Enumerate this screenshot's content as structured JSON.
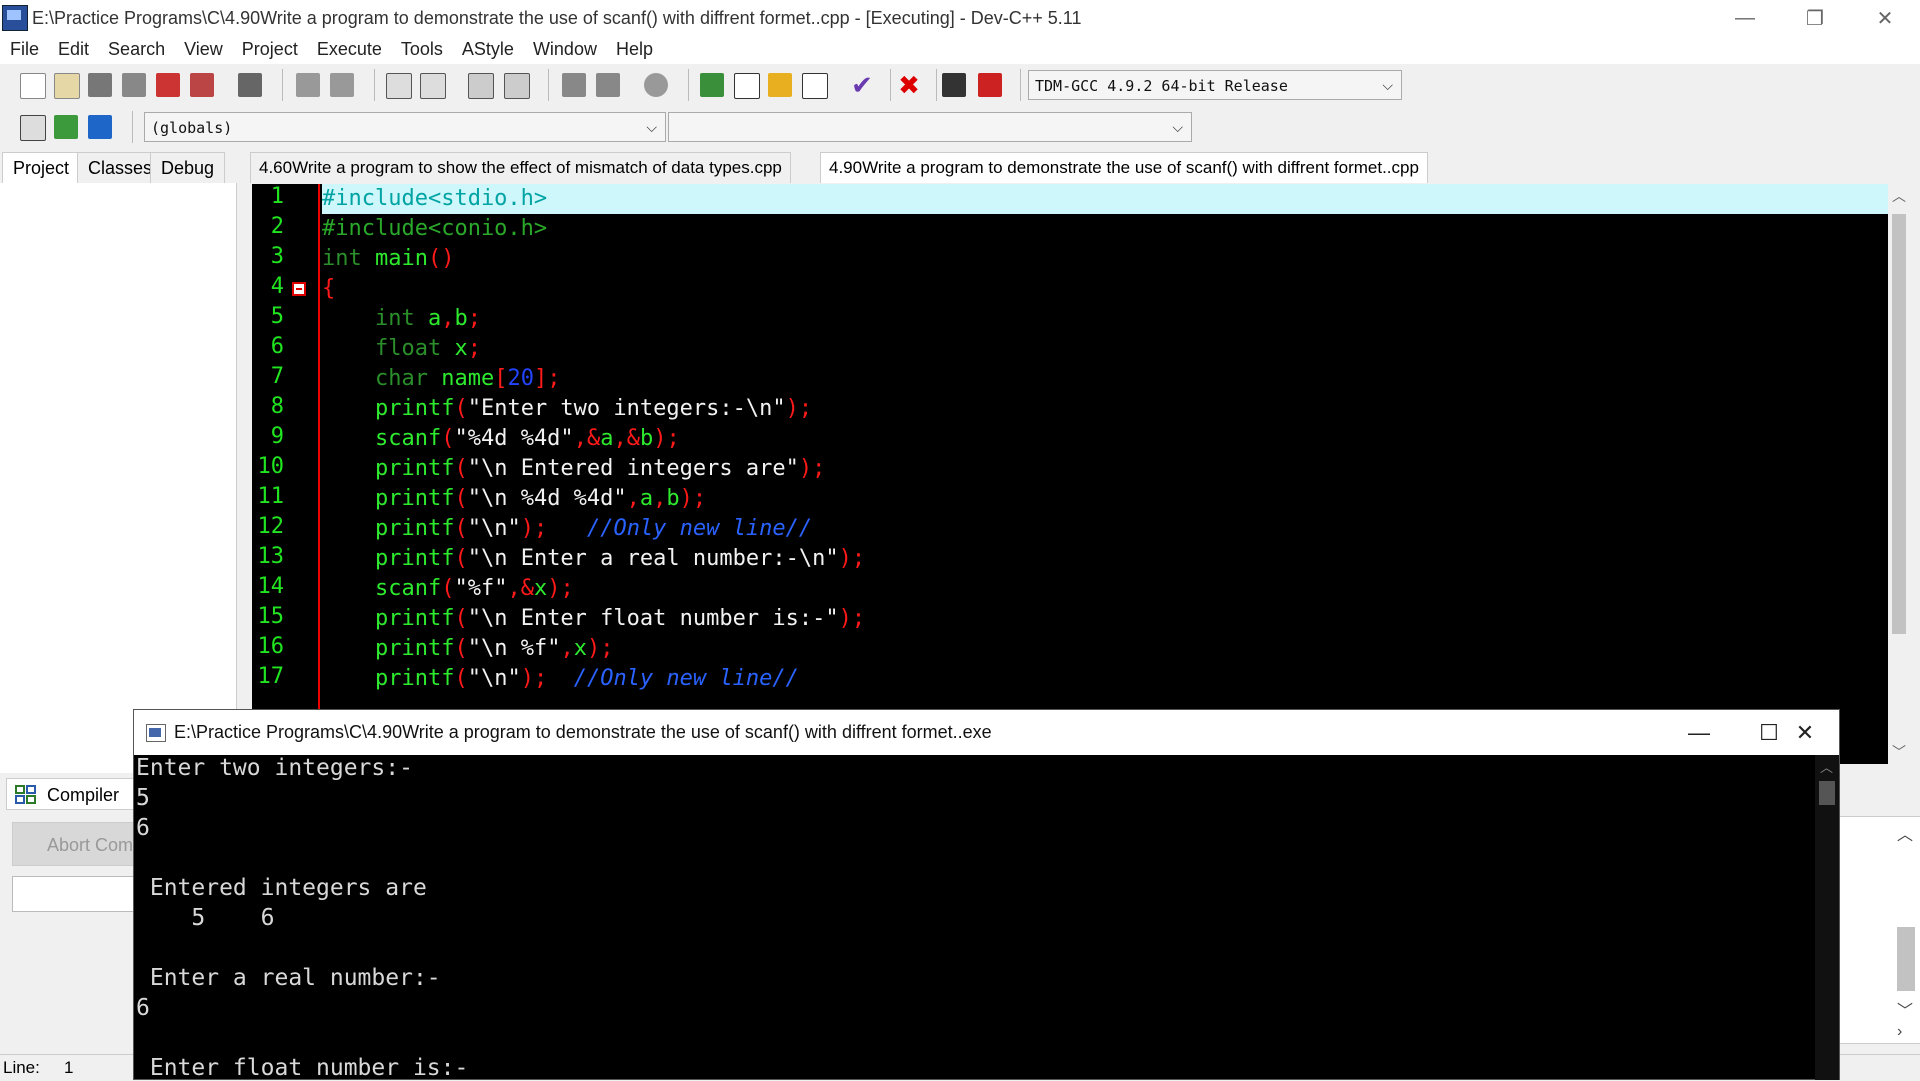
{
  "window": {
    "title": "E:\\Practice Programs\\C\\4.90Write a program to demonstrate the use of scanf() with diffrent formet..cpp - [Executing] - Dev-C++ 5.11",
    "minimize": "—",
    "restore": "❐",
    "close": "✕"
  },
  "menu": [
    "File",
    "Edit",
    "Search",
    "View",
    "Project",
    "Execute",
    "Tools",
    "AStyle",
    "Window",
    "Help"
  ],
  "toolbar": {
    "compiler_select": "TDM-GCC 4.9.2 64-bit Release",
    "scope_select": "(globals)",
    "function_select": ""
  },
  "left_tabs": [
    "Project",
    "Classes",
    "Debug"
  ],
  "editor_tabs": [
    "4.60Write a program to show the effect of mismatch of data types.cpp",
    "4.90Write a program to demonstrate the use of scanf() with diffrent formet..cpp"
  ],
  "code": {
    "line_numbers": [
      "1",
      "2",
      "3",
      "4",
      "5",
      "6",
      "7",
      "8",
      "9",
      "10",
      "11",
      "12",
      "13",
      "14",
      "15",
      "16",
      "17"
    ],
    "lines": [
      "#include<stdio.h>",
      "#include<conio.h>",
      "int main()",
      "{",
      "    int a,b;",
      "    float x;",
      "    char name[20];",
      "    printf(\"Enter two integers:-\\n\");",
      "    scanf(\"%4d %4d\",&a,&b);",
      "    printf(\"\\n Entered integers are\");",
      "    printf(\"\\n %4d %4d\",a,b);",
      "    printf(\"\\n\");   //Only new line//",
      "    printf(\"\\n Enter a real number:-\\n\");",
      "    scanf(\"%f\",&x);",
      "    printf(\"\\n Enter float number is:-\");",
      "    printf(\"\\n %f\",x);",
      "    printf(\"\\n\");  //Only new line//"
    ]
  },
  "bottom": {
    "compiler_tab": "Compiler",
    "abort_button": "Abort Compilation",
    "status_line_label": "Line:",
    "status_line_value": "1"
  },
  "console": {
    "title": "E:\\Practice Programs\\C\\4.90Write a program to demonstrate the use of scanf() with diffrent formet..exe",
    "minimize": "—",
    "maximize": "☐",
    "close": "✕",
    "lines": [
      "Enter two integers:-",
      "5",
      "6",
      "",
      " Entered integers are",
      "    5    6",
      "",
      " Enter a real number:-",
      "6",
      "",
      " Enter float number is:-"
    ]
  }
}
